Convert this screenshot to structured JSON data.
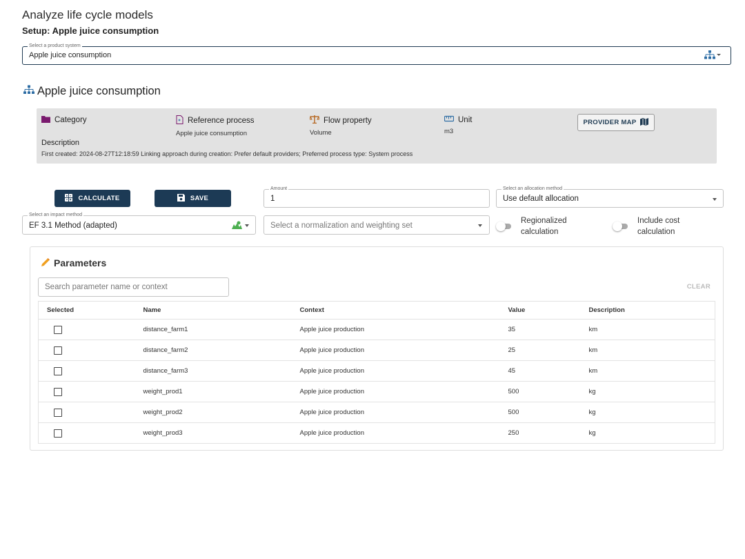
{
  "header": {
    "title": "Analyze life cycle models",
    "setup": "Setup: Apple juice consumption"
  },
  "product_system_select": {
    "legend": "Select a product system",
    "value": "Apple juice consumption",
    "icon": "product-system-tree-icon"
  },
  "system": {
    "title": "Apple juice consumption",
    "icon": "product-system-tree-icon",
    "category": {
      "label": "Category",
      "icon": "folder-icon",
      "color": "#7a1a6e"
    },
    "reference_process": {
      "label": "Reference process",
      "value": "Apple juice consumption",
      "icon": "process-icon"
    },
    "flow_property": {
      "label": "Flow property",
      "value": "Volume",
      "icon": "scale-icon"
    },
    "unit": {
      "label": "Unit",
      "value": "m3",
      "icon": "ruler-icon"
    },
    "provider_map_button": "PROVIDER MAP",
    "description_label": "Description",
    "description": "First created: 2024-08-27T12:18:59 Linking approach during creation: Prefer default providers; Preferred process type: System process"
  },
  "controls": {
    "calculate": "CALCULATE",
    "save": "SAVE",
    "amount": {
      "legend": "Amount",
      "value": "1"
    },
    "allocation": {
      "legend": "Select an allocation method",
      "value": "Use default allocation"
    },
    "impact_method": {
      "legend": "Select an impact method",
      "value": "EF 3.1 Method (adapted)"
    },
    "normalization": {
      "placeholder": "Select a normalization and weighting set"
    },
    "regionalized": {
      "label": "Regionalized calculation",
      "checked": false
    },
    "include_cost": {
      "label": "Include cost calculation",
      "checked": false
    }
  },
  "parameters": {
    "title": "Parameters",
    "search_placeholder": "Search parameter name or context",
    "clear": "CLEAR",
    "columns": [
      "Selected",
      "Name",
      "Context",
      "Value",
      "Description"
    ],
    "rows": [
      {
        "selected": false,
        "name": "distance_farm1",
        "context": "Apple juice production",
        "value": "35",
        "description": "km"
      },
      {
        "selected": false,
        "name": "distance_farm2",
        "context": "Apple juice production",
        "value": "25",
        "description": "km"
      },
      {
        "selected": false,
        "name": "distance_farm3",
        "context": "Apple juice production",
        "value": "45",
        "description": "km"
      },
      {
        "selected": false,
        "name": "weight_prod1",
        "context": "Apple juice production",
        "value": "500",
        "description": "kg"
      },
      {
        "selected": false,
        "name": "weight_prod2",
        "context": "Apple juice production",
        "value": "500",
        "description": "kg"
      },
      {
        "selected": false,
        "name": "weight_prod3",
        "context": "Apple juice production",
        "value": "250",
        "description": "kg"
      }
    ]
  },
  "colors": {
    "primary": "#1c3a55",
    "accent_icon": "#2e6da4",
    "impact_icon": "#4caf50",
    "pencil_icon": "#f0a020"
  }
}
